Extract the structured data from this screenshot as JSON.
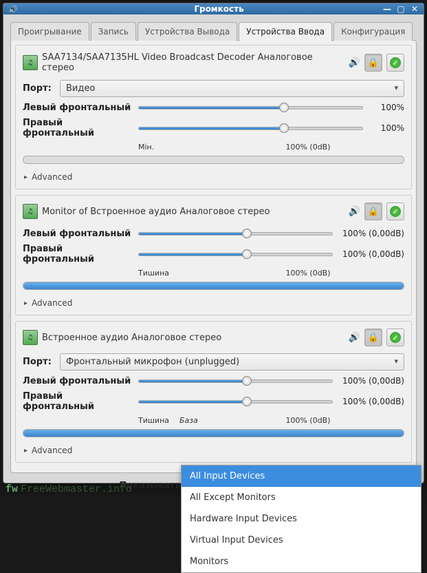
{
  "window": {
    "title": "Громкость"
  },
  "tabs": {
    "playback": "Проигрывание",
    "record": "Запись",
    "output_devices": "Устройства Вывода",
    "input_devices": "Устройства Ввода",
    "configuration": "Конфигурация"
  },
  "common": {
    "port_label": "Порт:",
    "advanced": "Advanced",
    "show_label": "Показывать:"
  },
  "scale": {
    "min": "Мін.",
    "silence": "Тишина",
    "base": "База",
    "hundred": "100% (0dB)"
  },
  "devices": [
    {
      "name": "SAA7134/SAA7135HL Video Broadcast Decoder Аналоговое стерео",
      "port": "Видео",
      "has_port": true,
      "scale_min": "min",
      "channels": [
        {
          "label": "Левый фронтальный",
          "value": "100%",
          "fill": 65
        },
        {
          "label": "Правый фронтальный",
          "value": "100%",
          "fill": 65
        }
      ],
      "vu": 0
    },
    {
      "name": "Monitor of Встроенное аудио Аналоговое стерео",
      "has_port": false,
      "scale_min": "silence",
      "channels": [
        {
          "label": "Левый фронтальный",
          "value": "100% (0,00dB)",
          "fill": 56
        },
        {
          "label": "Правый фронтальный",
          "value": "100% (0,00dB)",
          "fill": 56
        }
      ],
      "vu": 100
    },
    {
      "name": "Встроенное аудио Аналоговое стерео",
      "port": "Фронтальный микрофон (unplugged)",
      "has_port": true,
      "scale_min": "silence_base",
      "channels": [
        {
          "label": "Левый фронтальный",
          "value": "100% (0,00dB)",
          "fill": 56
        },
        {
          "label": "Правый фронтальный",
          "value": "100% (0,00dB)",
          "fill": 56
        }
      ],
      "vu": 100
    }
  ],
  "show_dropdown": {
    "selected": "All Input Devices",
    "options": [
      "All Input Devices",
      "All Except Monitors",
      "Hardware Input Devices",
      "Virtual Input Devices",
      "Monitors"
    ]
  },
  "watermark": {
    "prefix": "fw",
    "text": "FreeWebmaster.info"
  }
}
